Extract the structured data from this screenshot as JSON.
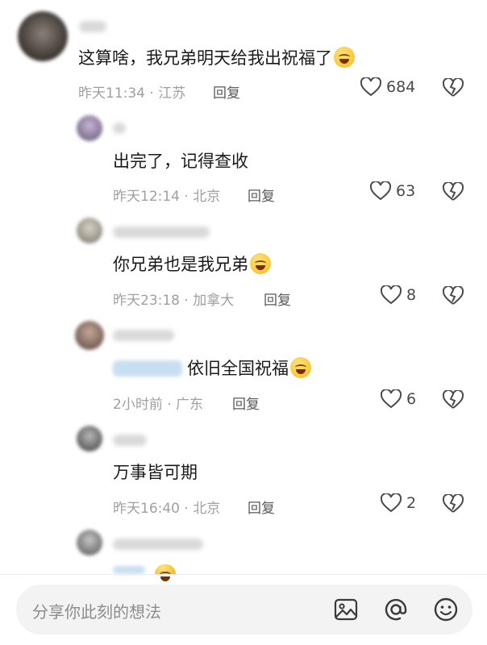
{
  "comments": [
    {
      "text": "这算啥，我兄弟明天给我出祝福了",
      "time": "昨天11:34 · 江苏",
      "reply": "回复",
      "likes": "684",
      "emoji": "laugh-cry"
    },
    {
      "text": "出完了，记得查收",
      "time": "昨天12:14 · 北京",
      "reply": "回复",
      "likes": "63"
    },
    {
      "text": "你兄弟也是我兄弟",
      "time": "昨天23:18 · 加拿大",
      "reply": "回复",
      "likes": "8",
      "emoji": "grin"
    },
    {
      "text": "依旧全国祝福",
      "time": "2小时前 · 广东",
      "reply": "回复",
      "likes": "6",
      "emoji": "laugh-cry"
    },
    {
      "text": "万事皆可期",
      "time": "昨天16:40 · 北京",
      "reply": "回复",
      "likes": "2"
    }
  ],
  "input": {
    "placeholder": "分享你此刻的想法"
  },
  "icons": {
    "image": "image-icon",
    "mention": "at-icon",
    "emoji": "emoji-icon",
    "like": "heart-icon",
    "dislike": "broken-heart-icon"
  },
  "colors": {
    "text": "#1a1a1a",
    "meta": "#a0a0a0",
    "input_bg": "#f3f3f3"
  }
}
